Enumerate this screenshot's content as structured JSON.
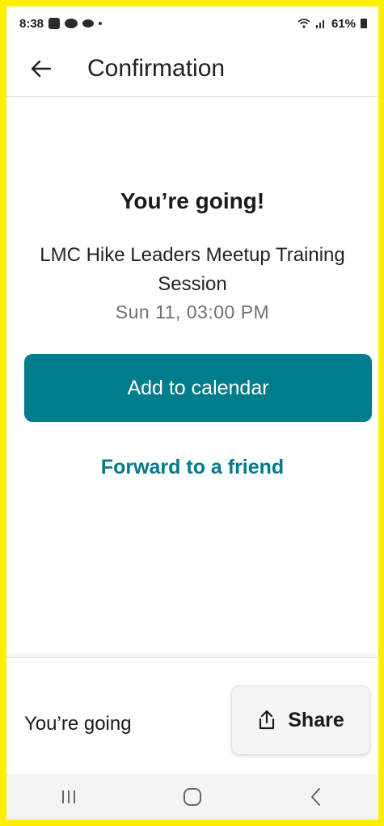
{
  "status_bar": {
    "time": "8:38",
    "battery": "61%",
    "icons": [
      "notification-icon",
      "app-icon",
      "cloud-icon",
      "dot-icon",
      "wifi-icon",
      "signal-icon",
      "battery-icon"
    ]
  },
  "app_bar": {
    "title": "Confirmation",
    "back_icon": "arrow-left-icon"
  },
  "content": {
    "heading": "You’re going!",
    "event_name": "LMC Hike Leaders Meetup Training Session",
    "event_date": "Sun 11, 03:00 PM",
    "calendar_button_label": "Add to calendar",
    "forward_link_label": "Forward to a friend"
  },
  "bottom_bar": {
    "status": "You’re going",
    "share_label": "Share",
    "share_icon": "share-icon"
  },
  "nav_bar": {
    "icons": [
      "recent-apps-icon",
      "home-icon",
      "back-icon"
    ]
  },
  "colors": {
    "primary": "#007d8c",
    "link": "#00798a",
    "frame": "#ffee00"
  }
}
